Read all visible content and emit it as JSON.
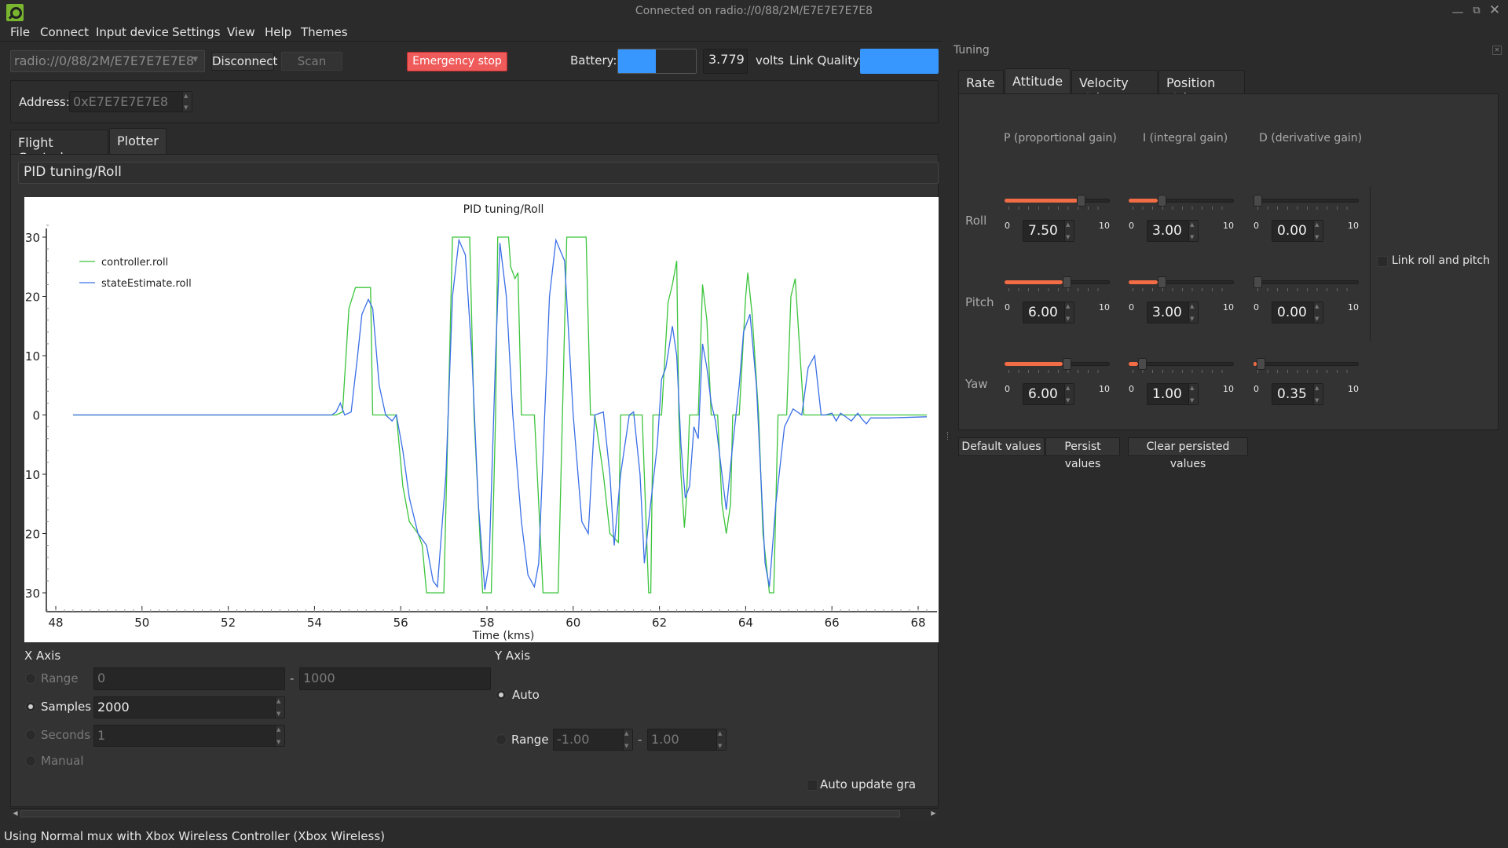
{
  "window": {
    "title": "Connected on radio://0/88/2M/E7E7E7E7E8",
    "controls": [
      "minimize",
      "restore",
      "close"
    ]
  },
  "menu": [
    "File",
    "Connect",
    "Input device",
    "Settings",
    "View",
    "Help",
    "Themes"
  ],
  "toolbar": {
    "uri": "radio://0/88/2M/E7E7E7E7E8",
    "disconnect": "Disconnect",
    "scan": "Scan",
    "emergency_stop": "Emergency stop",
    "battery_label": "Battery:",
    "battery_fill_fraction": 0.48,
    "battery_voltage": "3.779",
    "volts_label": "volts",
    "link_quality_label": "Link Quality:",
    "link_quality_fraction": 1.0
  },
  "address": {
    "label": "Address:",
    "value": "0xE7E7E7E7E8"
  },
  "tabs": [
    {
      "label": "Flight Control",
      "selected": false
    },
    {
      "label": "Plotter",
      "selected": true
    }
  ],
  "plotter": {
    "config_selected": "PID tuning/Roll",
    "x_axis": {
      "title": "X Axis",
      "options": [
        {
          "label": "Range",
          "checked": false,
          "enabled": false
        },
        {
          "label": "Samples",
          "checked": true,
          "enabled": true
        },
        {
          "label": "Seconds",
          "checked": false,
          "enabled": false
        },
        {
          "label": "Manual",
          "checked": false,
          "enabled": false
        }
      ],
      "range_from": "0",
      "range_to": "1000",
      "samples": "2000",
      "seconds": "1"
    },
    "y_axis": {
      "title": "Y Axis",
      "auto_label": "Auto",
      "auto_checked": true,
      "range_label": "Range",
      "range_checked": false,
      "range_from": "-1.00",
      "range_to": "1.00"
    },
    "auto_update_label": "Auto update gra",
    "auto_update_checked": false
  },
  "status_bar": "Using Normal mux with Xbox Wireless Controller (Xbox Wireless)",
  "tuning": {
    "title": "Tuning",
    "tabs": [
      {
        "label": "Rate",
        "selected": false
      },
      {
        "label": "Attitude",
        "selected": true
      },
      {
        "label": "Velocity ctrl",
        "selected": false
      },
      {
        "label": "Position ctrl",
        "selected": false
      }
    ],
    "columns": [
      "P (proportional gain)",
      "I (integral gain)",
      "D (derivative gain)"
    ],
    "slider_min": "0",
    "slider_max": "10",
    "rows": [
      {
        "label": "Roll",
        "values": [
          "7.50",
          "3.00",
          "0.00"
        ],
        "fractions": [
          0.75,
          0.3,
          0.0
        ]
      },
      {
        "label": "Pitch",
        "values": [
          "6.00",
          "3.00",
          "0.00"
        ],
        "fractions": [
          0.6,
          0.3,
          0.0
        ]
      },
      {
        "label": "Yaw",
        "values": [
          "6.00",
          "1.00",
          "0.35"
        ],
        "fractions": [
          0.6,
          0.1,
          0.035
        ]
      }
    ],
    "link_label": "Link roll and pitch",
    "link_checked": false,
    "buttons": [
      "Default values",
      "Persist values",
      "Clear persisted values"
    ]
  },
  "chart_data": {
    "type": "line",
    "title": "PID tuning/Roll",
    "xlabel": "Time (kms)",
    "ylabel": "",
    "xlim": [
      47.8,
      68.3
    ],
    "ylim": [
      -31.5,
      32.5
    ],
    "xticks": [
      "48",
      "50",
      "52",
      "54",
      "56",
      "58",
      "60",
      "62",
      "64",
      "66",
      "68"
    ],
    "yticks": [
      "30",
      "20",
      "10",
      "0",
      "-10",
      "-20",
      "-30"
    ],
    "legend_position": "top-left",
    "grid": false,
    "series": [
      {
        "name": "controller.roll",
        "color": "#3cc43c",
        "points": [
          [
            48.4,
            0
          ],
          [
            54.5,
            0
          ],
          [
            54.65,
            0.5
          ],
          [
            54.8,
            18
          ],
          [
            54.95,
            21.5
          ],
          [
            55.3,
            21.5
          ],
          [
            55.35,
            0
          ],
          [
            55.9,
            0
          ],
          [
            56.05,
            -12
          ],
          [
            56.2,
            -18
          ],
          [
            56.4,
            -20
          ],
          [
            56.5,
            -22
          ],
          [
            56.6,
            -30
          ],
          [
            57.0,
            -30
          ],
          [
            57.1,
            0
          ],
          [
            57.2,
            30
          ],
          [
            57.6,
            30
          ],
          [
            57.7,
            0
          ],
          [
            57.9,
            -30
          ],
          [
            58.1,
            -30
          ],
          [
            58.2,
            0
          ],
          [
            58.25,
            30
          ],
          [
            58.5,
            30
          ],
          [
            58.55,
            25
          ],
          [
            58.65,
            23
          ],
          [
            58.72,
            24
          ],
          [
            58.8,
            0
          ],
          [
            59.1,
            0
          ],
          [
            59.3,
            -30
          ],
          [
            59.65,
            -30
          ],
          [
            59.75,
            0
          ],
          [
            59.85,
            30
          ],
          [
            60.3,
            30
          ],
          [
            60.4,
            0
          ],
          [
            60.5,
            0
          ],
          [
            60.7,
            -10
          ],
          [
            60.85,
            -20
          ],
          [
            61.05,
            -21.5
          ],
          [
            61.1,
            0
          ],
          [
            61.6,
            0
          ],
          [
            61.7,
            -20
          ],
          [
            61.75,
            -30
          ],
          [
            61.8,
            -30
          ],
          [
            61.85,
            0
          ],
          [
            62.05,
            0
          ],
          [
            62.2,
            19
          ],
          [
            62.3,
            22
          ],
          [
            62.4,
            26
          ],
          [
            62.45,
            0
          ],
          [
            62.5,
            -10
          ],
          [
            62.58,
            -19
          ],
          [
            62.62,
            -15
          ],
          [
            62.65,
            -10
          ],
          [
            62.7,
            0
          ],
          [
            62.9,
            0
          ],
          [
            63.0,
            22
          ],
          [
            63.1,
            16
          ],
          [
            63.2,
            0
          ],
          [
            63.35,
            0
          ],
          [
            63.45,
            -15
          ],
          [
            63.55,
            -20
          ],
          [
            63.65,
            -15
          ],
          [
            63.7,
            0
          ],
          [
            63.85,
            0
          ],
          [
            64.0,
            20
          ],
          [
            64.05,
            24
          ],
          [
            64.15,
            17
          ],
          [
            64.3,
            0
          ],
          [
            64.4,
            -20
          ],
          [
            64.55,
            -30
          ],
          [
            64.65,
            -30
          ],
          [
            64.75,
            0
          ],
          [
            64.95,
            0
          ],
          [
            65.05,
            20
          ],
          [
            65.15,
            23
          ],
          [
            65.35,
            0
          ],
          [
            65.5,
            0
          ],
          [
            68.2,
            0
          ]
        ]
      },
      {
        "name": "stateEstimate.roll",
        "color": "#3a6fe6",
        "points": [
          [
            48.4,
            0
          ],
          [
            54.4,
            0
          ],
          [
            54.5,
            0.5
          ],
          [
            54.6,
            2
          ],
          [
            54.7,
            0
          ],
          [
            54.85,
            0.5
          ],
          [
            55.0,
            10
          ],
          [
            55.1,
            17
          ],
          [
            55.25,
            19.5
          ],
          [
            55.35,
            18
          ],
          [
            55.5,
            5
          ],
          [
            55.65,
            0
          ],
          [
            55.8,
            -1
          ],
          [
            55.9,
            0
          ],
          [
            56.05,
            -6
          ],
          [
            56.2,
            -14
          ],
          [
            56.4,
            -20
          ],
          [
            56.6,
            -22
          ],
          [
            56.75,
            -28
          ],
          [
            56.85,
            -29
          ],
          [
            57.05,
            -10
          ],
          [
            57.2,
            20
          ],
          [
            57.35,
            29.5
          ],
          [
            57.5,
            27
          ],
          [
            57.65,
            10
          ],
          [
            57.8,
            -15
          ],
          [
            57.95,
            -29.5
          ],
          [
            58.05,
            -25
          ],
          [
            58.2,
            10
          ],
          [
            58.3,
            29
          ],
          [
            58.45,
            20
          ],
          [
            58.6,
            0
          ],
          [
            58.8,
            -18
          ],
          [
            58.95,
            -27
          ],
          [
            59.1,
            -29
          ],
          [
            59.2,
            -25
          ],
          [
            59.45,
            20
          ],
          [
            59.6,
            29.5
          ],
          [
            59.8,
            26
          ],
          [
            60.0,
            0
          ],
          [
            60.2,
            -18
          ],
          [
            60.35,
            -20
          ],
          [
            60.5,
            0
          ],
          [
            60.7,
            0.5
          ],
          [
            60.85,
            -10
          ],
          [
            60.95,
            -22
          ],
          [
            61.1,
            -10
          ],
          [
            61.3,
            0
          ],
          [
            61.4,
            0.5
          ],
          [
            61.55,
            -10
          ],
          [
            61.65,
            -25
          ],
          [
            61.75,
            -18
          ],
          [
            61.95,
            -5
          ],
          [
            62.05,
            6
          ],
          [
            62.15,
            8
          ],
          [
            62.3,
            15
          ],
          [
            62.4,
            10
          ],
          [
            62.5,
            -5
          ],
          [
            62.6,
            -14
          ],
          [
            62.7,
            -12
          ],
          [
            62.8,
            -2
          ],
          [
            62.9,
            -4
          ],
          [
            63.0,
            12
          ],
          [
            63.1,
            8
          ],
          [
            63.2,
            2
          ],
          [
            63.3,
            -1
          ],
          [
            63.45,
            -10
          ],
          [
            63.55,
            -16
          ],
          [
            63.7,
            -5
          ],
          [
            63.85,
            5
          ],
          [
            63.95,
            14
          ],
          [
            64.1,
            17
          ],
          [
            64.25,
            5
          ],
          [
            64.35,
            -10
          ],
          [
            64.45,
            -25
          ],
          [
            64.55,
            -29
          ],
          [
            64.7,
            -15
          ],
          [
            64.9,
            -2
          ],
          [
            65.1,
            1
          ],
          [
            65.3,
            0
          ],
          [
            65.45,
            8
          ],
          [
            65.6,
            10
          ],
          [
            65.75,
            0
          ],
          [
            65.85,
            0
          ],
          [
            66.0,
            0.3
          ],
          [
            66.1,
            -1
          ],
          [
            66.2,
            0.3
          ],
          [
            66.3,
            -0.2
          ],
          [
            66.45,
            -1
          ],
          [
            66.6,
            0.3
          ],
          [
            66.7,
            -0.7
          ],
          [
            66.8,
            -1.5
          ],
          [
            66.9,
            -0.5
          ],
          [
            67.3,
            -0.5
          ],
          [
            68.2,
            -0.3
          ]
        ]
      }
    ]
  }
}
